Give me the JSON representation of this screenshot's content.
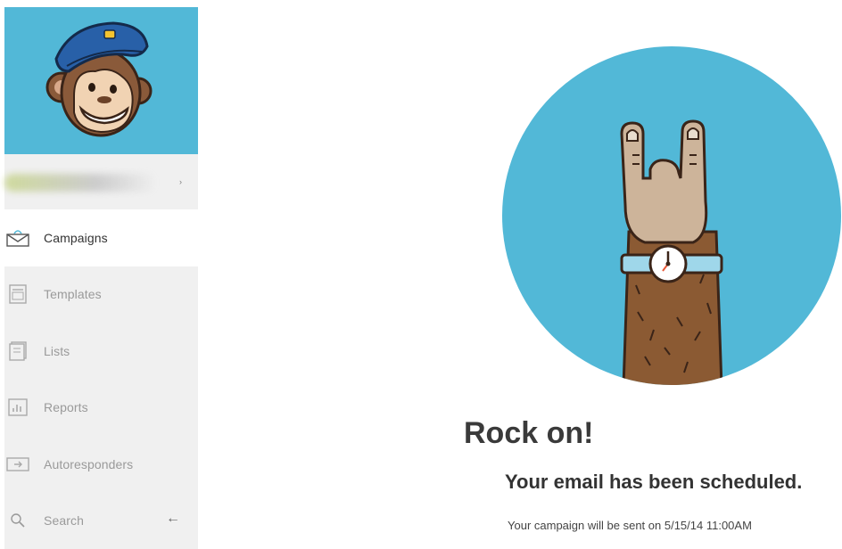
{
  "sidebar": {
    "items": [
      {
        "label": "Campaigns",
        "icon": "envelope-icon",
        "active": true
      },
      {
        "label": "Templates",
        "icon": "template-icon",
        "active": false
      },
      {
        "label": "Lists",
        "icon": "list-icon",
        "active": false
      },
      {
        "label": "Reports",
        "icon": "bar-chart-icon",
        "active": false
      },
      {
        "label": "Autoresponders",
        "icon": "autoresponder-icon",
        "active": false
      },
      {
        "label": "Search",
        "icon": "search-icon",
        "active": false
      }
    ],
    "collapse_symbol": "←",
    "account_caret": "›"
  },
  "main": {
    "title": "Rock on!",
    "subtitle": "Your email has been scheduled.",
    "detail": "Your campaign will be sent on 5/15/14 11:00AM"
  },
  "colors": {
    "brand_blue": "#52b8d7",
    "sidebar_bg": "#f0f0f0",
    "arm_brown": "#8b5a33",
    "hand_tan": "#cdb49a",
    "watch_band": "#9fd7ea"
  }
}
